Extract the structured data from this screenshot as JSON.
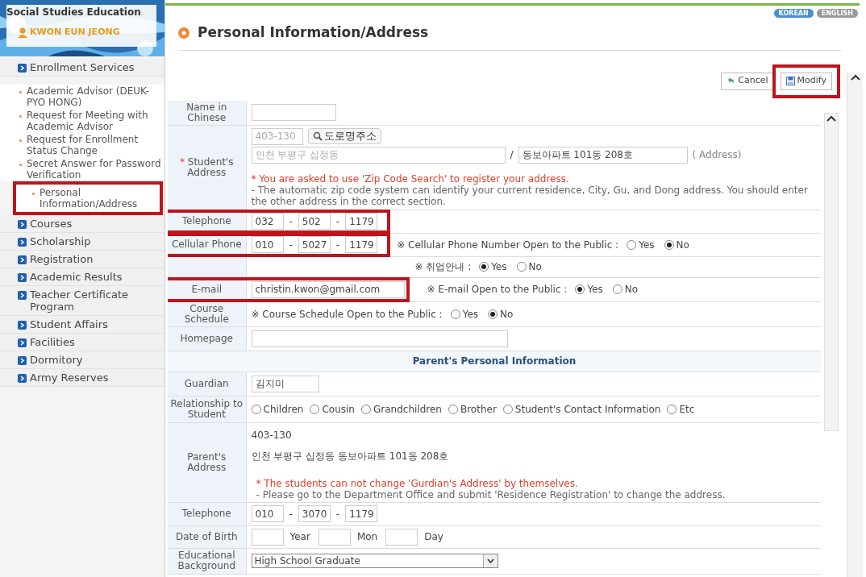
{
  "header": {
    "department": "Social Studies Education",
    "user_name": "KWON EUN JEONG"
  },
  "sidebar": {
    "items": [
      {
        "kind": "section",
        "label": "Enrollment Services",
        "highlighted": false
      },
      {
        "kind": "sub",
        "label": "Academic Advisor (DEUK-PYO HONG)",
        "highlighted": false
      },
      {
        "kind": "sub",
        "label": "Request for Meeting with Academic Advisor",
        "highlighted": false
      },
      {
        "kind": "sub",
        "label": "Request for Enrollment Status Change",
        "highlighted": false
      },
      {
        "kind": "sub",
        "label": "Secret Answer for Password Verification",
        "highlighted": false
      },
      {
        "kind": "sub",
        "label": "Personal Information/Address",
        "highlighted": true
      },
      {
        "kind": "section",
        "label": "Courses",
        "highlighted": false
      },
      {
        "kind": "section",
        "label": "Scholarship",
        "highlighted": false
      },
      {
        "kind": "section",
        "label": "Registration",
        "highlighted": false
      },
      {
        "kind": "section",
        "label": "Academic Results",
        "highlighted": false
      },
      {
        "kind": "section",
        "label": "Teacher Certificate Program",
        "highlighted": false
      },
      {
        "kind": "section",
        "label": "Student Affairs",
        "highlighted": false
      },
      {
        "kind": "section",
        "label": "Facilities",
        "highlighted": false
      },
      {
        "kind": "section",
        "label": "Dormitory",
        "highlighted": false
      },
      {
        "kind": "section",
        "label": "Army Reserves",
        "highlighted": false
      }
    ]
  },
  "languages": [
    {
      "label": "KOREAN",
      "selected": true
    },
    {
      "label": "ENGLISH",
      "selected": false
    }
  ],
  "page_title": "Personal Information/Address",
  "buttons": [
    {
      "kind": "cancel",
      "label": "Cancel",
      "highlighted": false
    },
    {
      "kind": "modify",
      "label": "Modify",
      "highlighted": true
    }
  ],
  "form": [
    {
      "kind": "text",
      "label": "Name in Chinese",
      "highlighted": false
    },
    {
      "kind": "student_address",
      "required_mark": "*",
      "label": "Student's Address",
      "zip": "403-130",
      "zip_button": "도로명주소",
      "address1": "인천 부평구 십정동",
      "slash": "/",
      "address2": "동보아파트 101동 208호",
      "address_hint": "( Address)",
      "notice": "* You are asked to use 'Zip Code Search' to register your address.",
      "help": "- The automatic zip code system can identify your current residence, City, Gu, and Dong address. You should enter the other address in the correct section."
    },
    {
      "kind": "phone",
      "label": "Telephone",
      "parts": [
        "032",
        "502",
        "1179"
      ],
      "dash": "-",
      "highlighted": true
    },
    {
      "kind": "phone",
      "label": "Cellular Phone",
      "parts": [
        "010",
        "5027",
        "1179"
      ],
      "dash": "-",
      "highlighted": true,
      "public": {
        "note": "※ Cellular Phone Number  Open to the Public :",
        "options": [
          {
            "label": "Yes",
            "selected": false
          },
          {
            "label": "No",
            "selected": true
          }
        ]
      }
    },
    {
      "kind": "choices",
      "public": {
        "note": "※ 취업안내 :",
        "options": [
          {
            "label": "Yes",
            "selected": true
          },
          {
            "label": "No",
            "selected": false
          }
        ]
      }
    },
    {
      "kind": "text",
      "label": "E-mail",
      "value": "christin.kwon@gmail.com",
      "highlighted": true,
      "public": {
        "note": "※ E-mail Open to the Public :",
        "options": [
          {
            "label": "Yes",
            "selected": true
          },
          {
            "label": "No",
            "selected": false
          }
        ]
      }
    },
    {
      "kind": "choices",
      "label": "Course Schedule",
      "public": {
        "note": "※ Course Schedule  Open to the Public :",
        "options": [
          {
            "label": "Yes",
            "selected": false
          },
          {
            "label": "No",
            "selected": true
          }
        ]
      }
    },
    {
      "kind": "text",
      "label": "Homepage",
      "highlighted": false
    },
    {
      "kind": "heading",
      "label": "Parent's Personal Information"
    },
    {
      "kind": "text",
      "label": "Guardian",
      "value": "김지미",
      "highlighted": false
    },
    {
      "kind": "radios",
      "label": "Relationship to Student",
      "options": [
        {
          "label": "Children",
          "selected": false
        },
        {
          "label": "Cousin",
          "selected": false
        },
        {
          "label": "Grandchildren",
          "selected": false
        },
        {
          "label": "Brother",
          "selected": false
        },
        {
          "label": "Student's Contact Information",
          "selected": false
        },
        {
          "label": "Etc",
          "selected": false
        }
      ]
    },
    {
      "kind": "info",
      "label": "Parent's Address",
      "lines": [
        "403-130",
        "인천 부평구 십정동 동보아파트 101동 208호"
      ],
      "notice": "* The students can not change 'Gurdian's Address' by themselves.",
      "help": "- Please go to the Department Office and submit 'Residence Registration' to change the address."
    },
    {
      "kind": "phone",
      "label": "Telephone",
      "parts": [
        "010",
        "3070",
        "1179"
      ],
      "dash": "-",
      "highlighted": false
    },
    {
      "kind": "date",
      "label": "Date of Birth",
      "units": [
        "Year",
        "Mon",
        "Day"
      ]
    },
    {
      "kind": "select",
      "label": "Educational Background",
      "value": "High School Graduate"
    }
  ]
}
